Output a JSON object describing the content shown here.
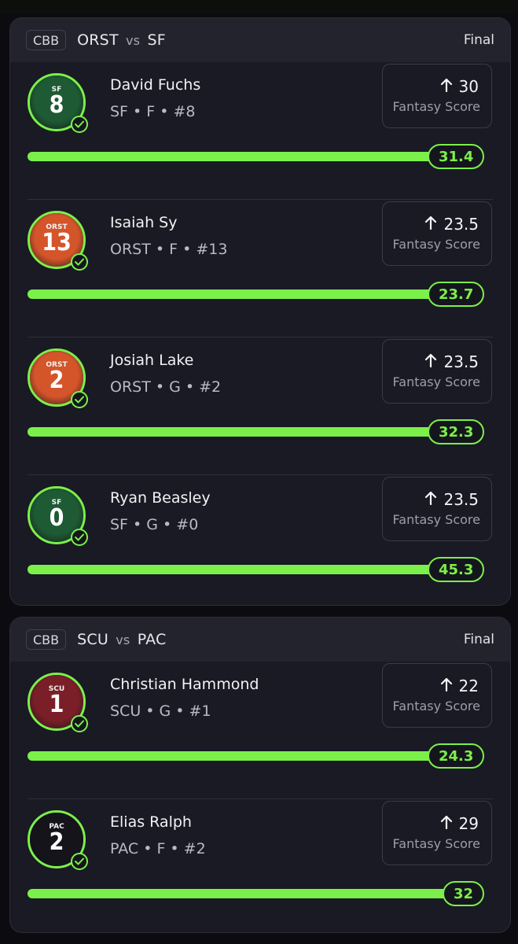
{
  "colors": {
    "accent": "#7cf04a",
    "card_bg": "#191a23",
    "header_bg": "#22232d",
    "page_bg": "#0b0b10"
  },
  "games": [
    {
      "league": "CBB",
      "team_a": "ORST",
      "vs": "vs",
      "team_b": "SF",
      "status": "Final",
      "players": [
        {
          "name": "David Fuchs",
          "meta": "SF • F • #8",
          "jersey_team": "SF",
          "jersey_number": "8",
          "jersey_color": "#1e5a33",
          "line": "30",
          "line_label": "Fantasy Score",
          "actual": "31.4",
          "progress": 1.0,
          "trend_icon": "arrow-up-icon"
        },
        {
          "name": "Isaiah Sy",
          "meta": "ORST • F • #13",
          "jersey_team": "ORST",
          "jersey_number": "13",
          "jersey_color": "#d4552a",
          "line": "23.5",
          "line_label": "Fantasy Score",
          "actual": "23.7",
          "progress": 1.0,
          "trend_icon": "arrow-up-icon"
        },
        {
          "name": "Josiah Lake",
          "meta": "ORST • G • #2",
          "jersey_team": "ORST",
          "jersey_number": "2",
          "jersey_color": "#d4552a",
          "line": "23.5",
          "line_label": "Fantasy Score",
          "actual": "32.3",
          "progress": 1.0,
          "trend_icon": "arrow-up-icon"
        },
        {
          "name": "Ryan Beasley",
          "meta": "SF • G • #0",
          "jersey_team": "SF",
          "jersey_number": "0",
          "jersey_color": "#1e5a33",
          "line": "23.5",
          "line_label": "Fantasy Score",
          "actual": "45.3",
          "progress": 1.0,
          "trend_icon": "arrow-up-icon"
        }
      ]
    },
    {
      "league": "CBB",
      "team_a": "SCU",
      "vs": "vs",
      "team_b": "PAC",
      "status": "Final",
      "players": [
        {
          "name": "Christian Hammond",
          "meta": "SCU • G • #1",
          "jersey_team": "SCU",
          "jersey_number": "1",
          "jersey_color": "#7a1f27",
          "line": "22",
          "line_label": "Fantasy Score",
          "actual": "24.3",
          "progress": 1.0,
          "trend_icon": "arrow-up-icon"
        },
        {
          "name": "Elias Ralph",
          "meta": "PAC • F • #2",
          "jersey_team": "PAC",
          "jersey_number": "2",
          "jersey_color": "#14141a",
          "line": "29",
          "line_label": "Fantasy Score",
          "actual": "32",
          "progress": 1.0,
          "trend_icon": "arrow-up-icon"
        }
      ]
    }
  ]
}
